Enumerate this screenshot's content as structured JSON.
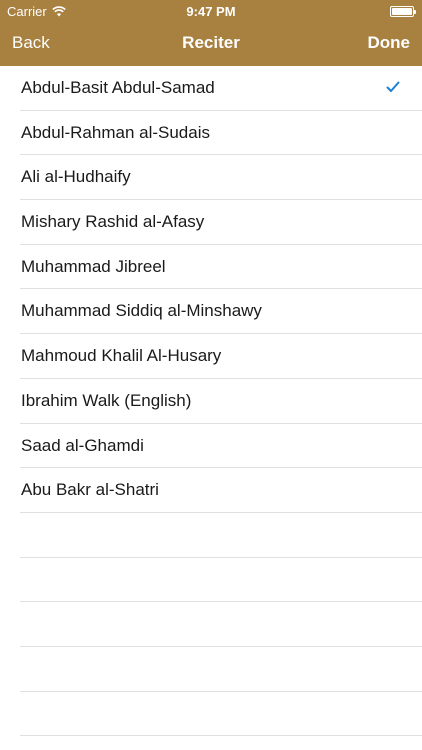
{
  "status_bar": {
    "carrier": "Carrier",
    "time": "9:47 PM",
    "battery_level": 1.0
  },
  "nav": {
    "back_label": "Back",
    "title": "Reciter",
    "done_label": "Done"
  },
  "colors": {
    "header_bg": "#a8803f",
    "checkmark": "#1a7fd9"
  },
  "reciters": [
    {
      "label": "Abdul-Basit Abdul-Samad",
      "selected": true
    },
    {
      "label": "Abdul-Rahman al-Sudais",
      "selected": false
    },
    {
      "label": "Ali al-Hudhaify",
      "selected": false
    },
    {
      "label": "Mishary Rashid al-Afasy",
      "selected": false
    },
    {
      "label": "Muhammad Jibreel",
      "selected": false
    },
    {
      "label": "Muhammad Siddiq al-Minshawy",
      "selected": false
    },
    {
      "label": "Mahmoud Khalil Al-Husary",
      "selected": false
    },
    {
      "label": "Ibrahim Walk (English)",
      "selected": false
    },
    {
      "label": "Saad al-Ghamdi",
      "selected": false
    },
    {
      "label": "Abu Bakr al-Shatri",
      "selected": false
    }
  ]
}
